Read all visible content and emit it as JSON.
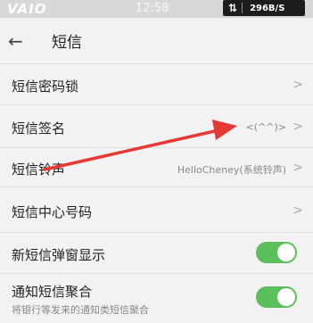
{
  "status_bar": {
    "brand": "VAIO",
    "time": "12:58",
    "net_speed": "296B/S"
  },
  "header": {
    "title": "短信"
  },
  "rows": [
    {
      "label": "短信密码锁"
    },
    {
      "label": "短信签名",
      "value": "<(^^)>"
    },
    {
      "label": "短信铃声",
      "value": "HelloCheney(系统铃声)"
    },
    {
      "label": "短信中心号码"
    },
    {
      "label": "新短信弹窗显示",
      "toggle_on": true
    },
    {
      "label": "通知短信聚合",
      "subtitle": "将银行等发来的通知类短信聚合",
      "toggle_on": true
    }
  ],
  "colors": {
    "toggle_on": "#5bbf5c",
    "annotation_arrow": "#e53935",
    "background": "#f2f2f2"
  },
  "icons": {
    "back": "back-arrow-icon",
    "chevron": "chevron-right-icon",
    "network": "data-transfer-icon"
  }
}
